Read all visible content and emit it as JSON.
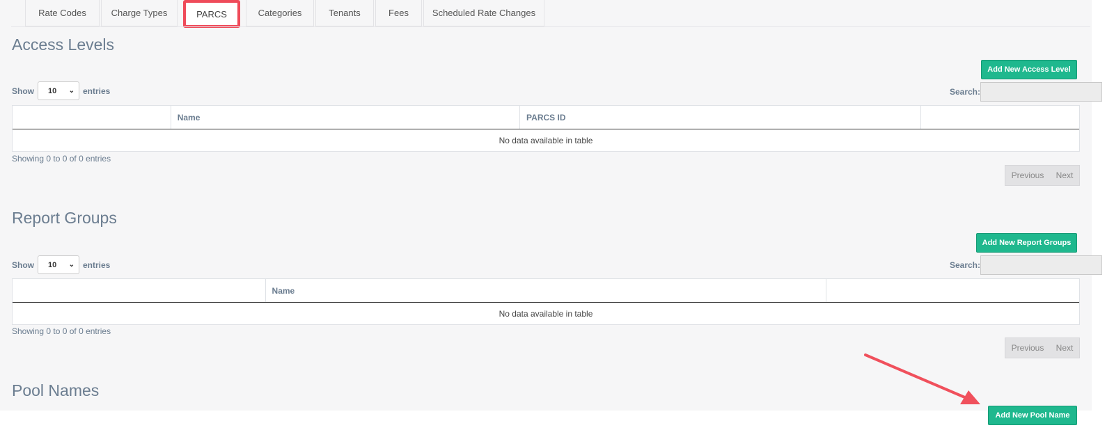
{
  "tabs": [
    {
      "label": "Rate Codes"
    },
    {
      "label": "Charge Types"
    },
    {
      "label": "PARCS",
      "active": true
    },
    {
      "label": "Categories"
    },
    {
      "label": "Tenants"
    },
    {
      "label": "Fees"
    },
    {
      "label": "Scheduled Rate Changes"
    }
  ],
  "access_levels": {
    "title": "Access Levels",
    "add_button": "Add New Access Level",
    "show_label": "Show",
    "page_size": "10",
    "entries_label": "entries",
    "search_label": "Search:",
    "columns": [
      "",
      "Name",
      "PARCS ID",
      ""
    ],
    "empty_message": "No data available in table",
    "info": "Showing 0 to 0 of 0 entries",
    "previous": "Previous",
    "next": "Next"
  },
  "report_groups": {
    "title": "Report Groups",
    "add_button": "Add New Report Groups",
    "show_label": "Show",
    "page_size": "10",
    "entries_label": "entries",
    "search_label": "Search:",
    "columns": [
      "",
      "Name",
      ""
    ],
    "empty_message": "No data available in table",
    "info": "Showing 0 to 0 of 0 entries",
    "previous": "Previous",
    "next": "Next"
  },
  "pool_names": {
    "title": "Pool Names",
    "add_button": "Add New Pool Name"
  },
  "colors": {
    "accent": "#1fb88e",
    "highlight": "#ef4b5a",
    "title_text": "#6b7d90"
  }
}
